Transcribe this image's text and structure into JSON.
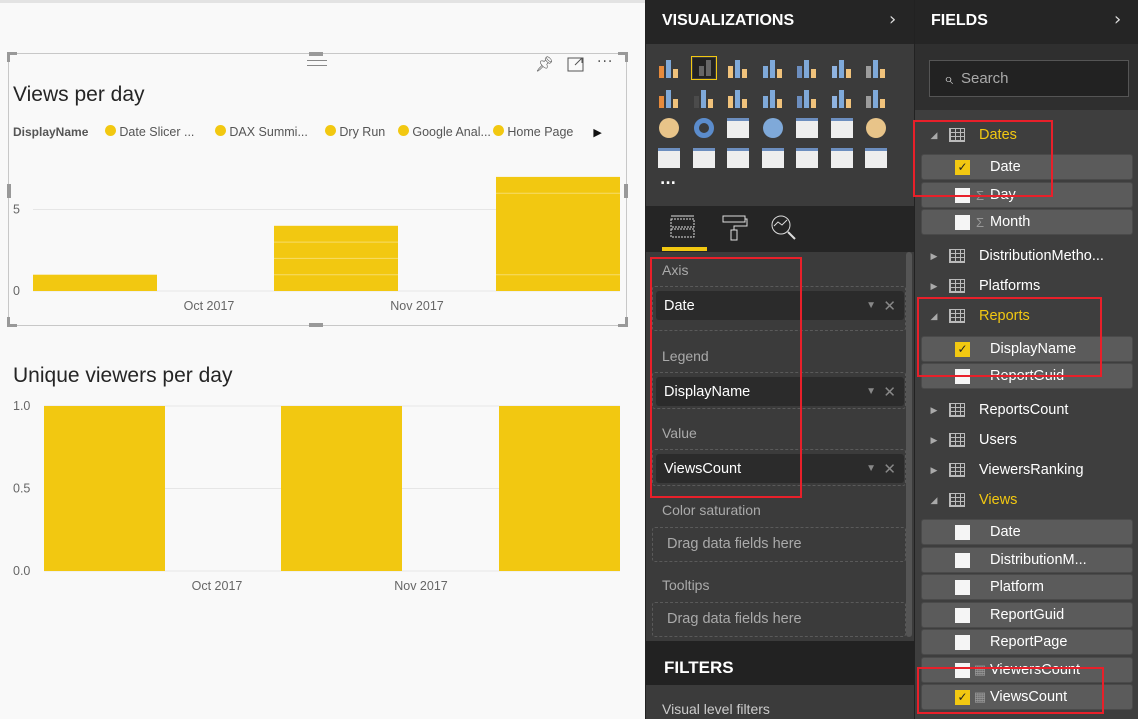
{
  "colors": {
    "bar": "#f2c811",
    "accent": "#f2c811",
    "highlight": "#e8202a"
  },
  "visual1": {
    "title": "Views per day",
    "legend_title": "DisplayName",
    "legend_items": [
      "Date Slicer ...",
      "DAX Summi...",
      "Dry Run",
      "Google Anal...",
      "Home Page"
    ],
    "icons": [
      "pin-icon",
      "focus-mode-icon",
      "more-options-icon"
    ]
  },
  "visual2": {
    "title": "Unique viewers per day"
  },
  "chart_data": [
    {
      "type": "bar",
      "title": "Views per day",
      "xlabel": "",
      "ylabel": "",
      "ylim": [
        0,
        7.5
      ],
      "y_ticks": [
        "0",
        "5"
      ],
      "x_ticks": [
        "Oct 2017",
        "Nov 2017"
      ],
      "stacked": true,
      "values": [
        1,
        4,
        7
      ],
      "stacks": [
        [
          1
        ],
        [
          1,
          1,
          1,
          1
        ],
        [
          1,
          5,
          1
        ]
      ],
      "grid": true,
      "legend": "top"
    },
    {
      "type": "bar",
      "title": "Unique viewers per day",
      "xlabel": "",
      "ylabel": "",
      "ylim": [
        0,
        1
      ],
      "y_ticks": [
        "0.0",
        "0.5",
        "1.0"
      ],
      "x_ticks": [
        "Oct 2017",
        "Nov 2017"
      ],
      "values": [
        1,
        1,
        1
      ],
      "grid": true
    }
  ],
  "visualizations": {
    "title": "VISUALIZATIONS",
    "selected_visual": "stacked-column-chart",
    "more": "...",
    "tabs": [
      "fields-tab",
      "format-tab",
      "analytics-tab"
    ],
    "wells": [
      {
        "label": "Axis",
        "value": "Date"
      },
      {
        "label": "Legend",
        "value": "DisplayName"
      },
      {
        "label": "Value",
        "value": "ViewsCount"
      },
      {
        "label": "Color saturation",
        "placeholder": "Drag data fields here"
      },
      {
        "label": "Tooltips",
        "placeholder": "Drag data fields here"
      }
    ],
    "filters_title": "FILTERS",
    "visual_level_filters": "Visual level filters"
  },
  "fields": {
    "title": "FIELDS",
    "search_placeholder": "Search",
    "rows": [
      {
        "kind": "table",
        "name": "Dates",
        "expanded": true,
        "active": true
      },
      {
        "kind": "field",
        "name": "Date",
        "checked": true
      },
      {
        "kind": "field",
        "name": "Day",
        "checked": false,
        "sigma": true
      },
      {
        "kind": "field",
        "name": "Month",
        "checked": false,
        "sigma": true
      },
      {
        "kind": "table",
        "name": "DistributionMetho...",
        "expanded": false
      },
      {
        "kind": "table",
        "name": "Platforms",
        "expanded": false
      },
      {
        "kind": "table",
        "name": "Reports",
        "expanded": true,
        "active": true
      },
      {
        "kind": "field",
        "name": "DisplayName",
        "checked": true
      },
      {
        "kind": "field",
        "name": "ReportGuid",
        "checked": false
      },
      {
        "kind": "table",
        "name": "ReportsCount",
        "expanded": false
      },
      {
        "kind": "table",
        "name": "Users",
        "expanded": false
      },
      {
        "kind": "table",
        "name": "ViewersRanking",
        "expanded": false
      },
      {
        "kind": "table",
        "name": "Views",
        "expanded": true,
        "active": true
      },
      {
        "kind": "field",
        "name": "Date",
        "checked": false
      },
      {
        "kind": "field",
        "name": "DistributionM...",
        "checked": false
      },
      {
        "kind": "field",
        "name": "Platform",
        "checked": false
      },
      {
        "kind": "field",
        "name": "ReportGuid",
        "checked": false
      },
      {
        "kind": "field",
        "name": "ReportPage",
        "checked": false
      },
      {
        "kind": "field",
        "name": "ViewersCount",
        "checked": false,
        "calc": true
      },
      {
        "kind": "field",
        "name": "ViewsCount",
        "checked": true,
        "calc": true
      }
    ]
  }
}
